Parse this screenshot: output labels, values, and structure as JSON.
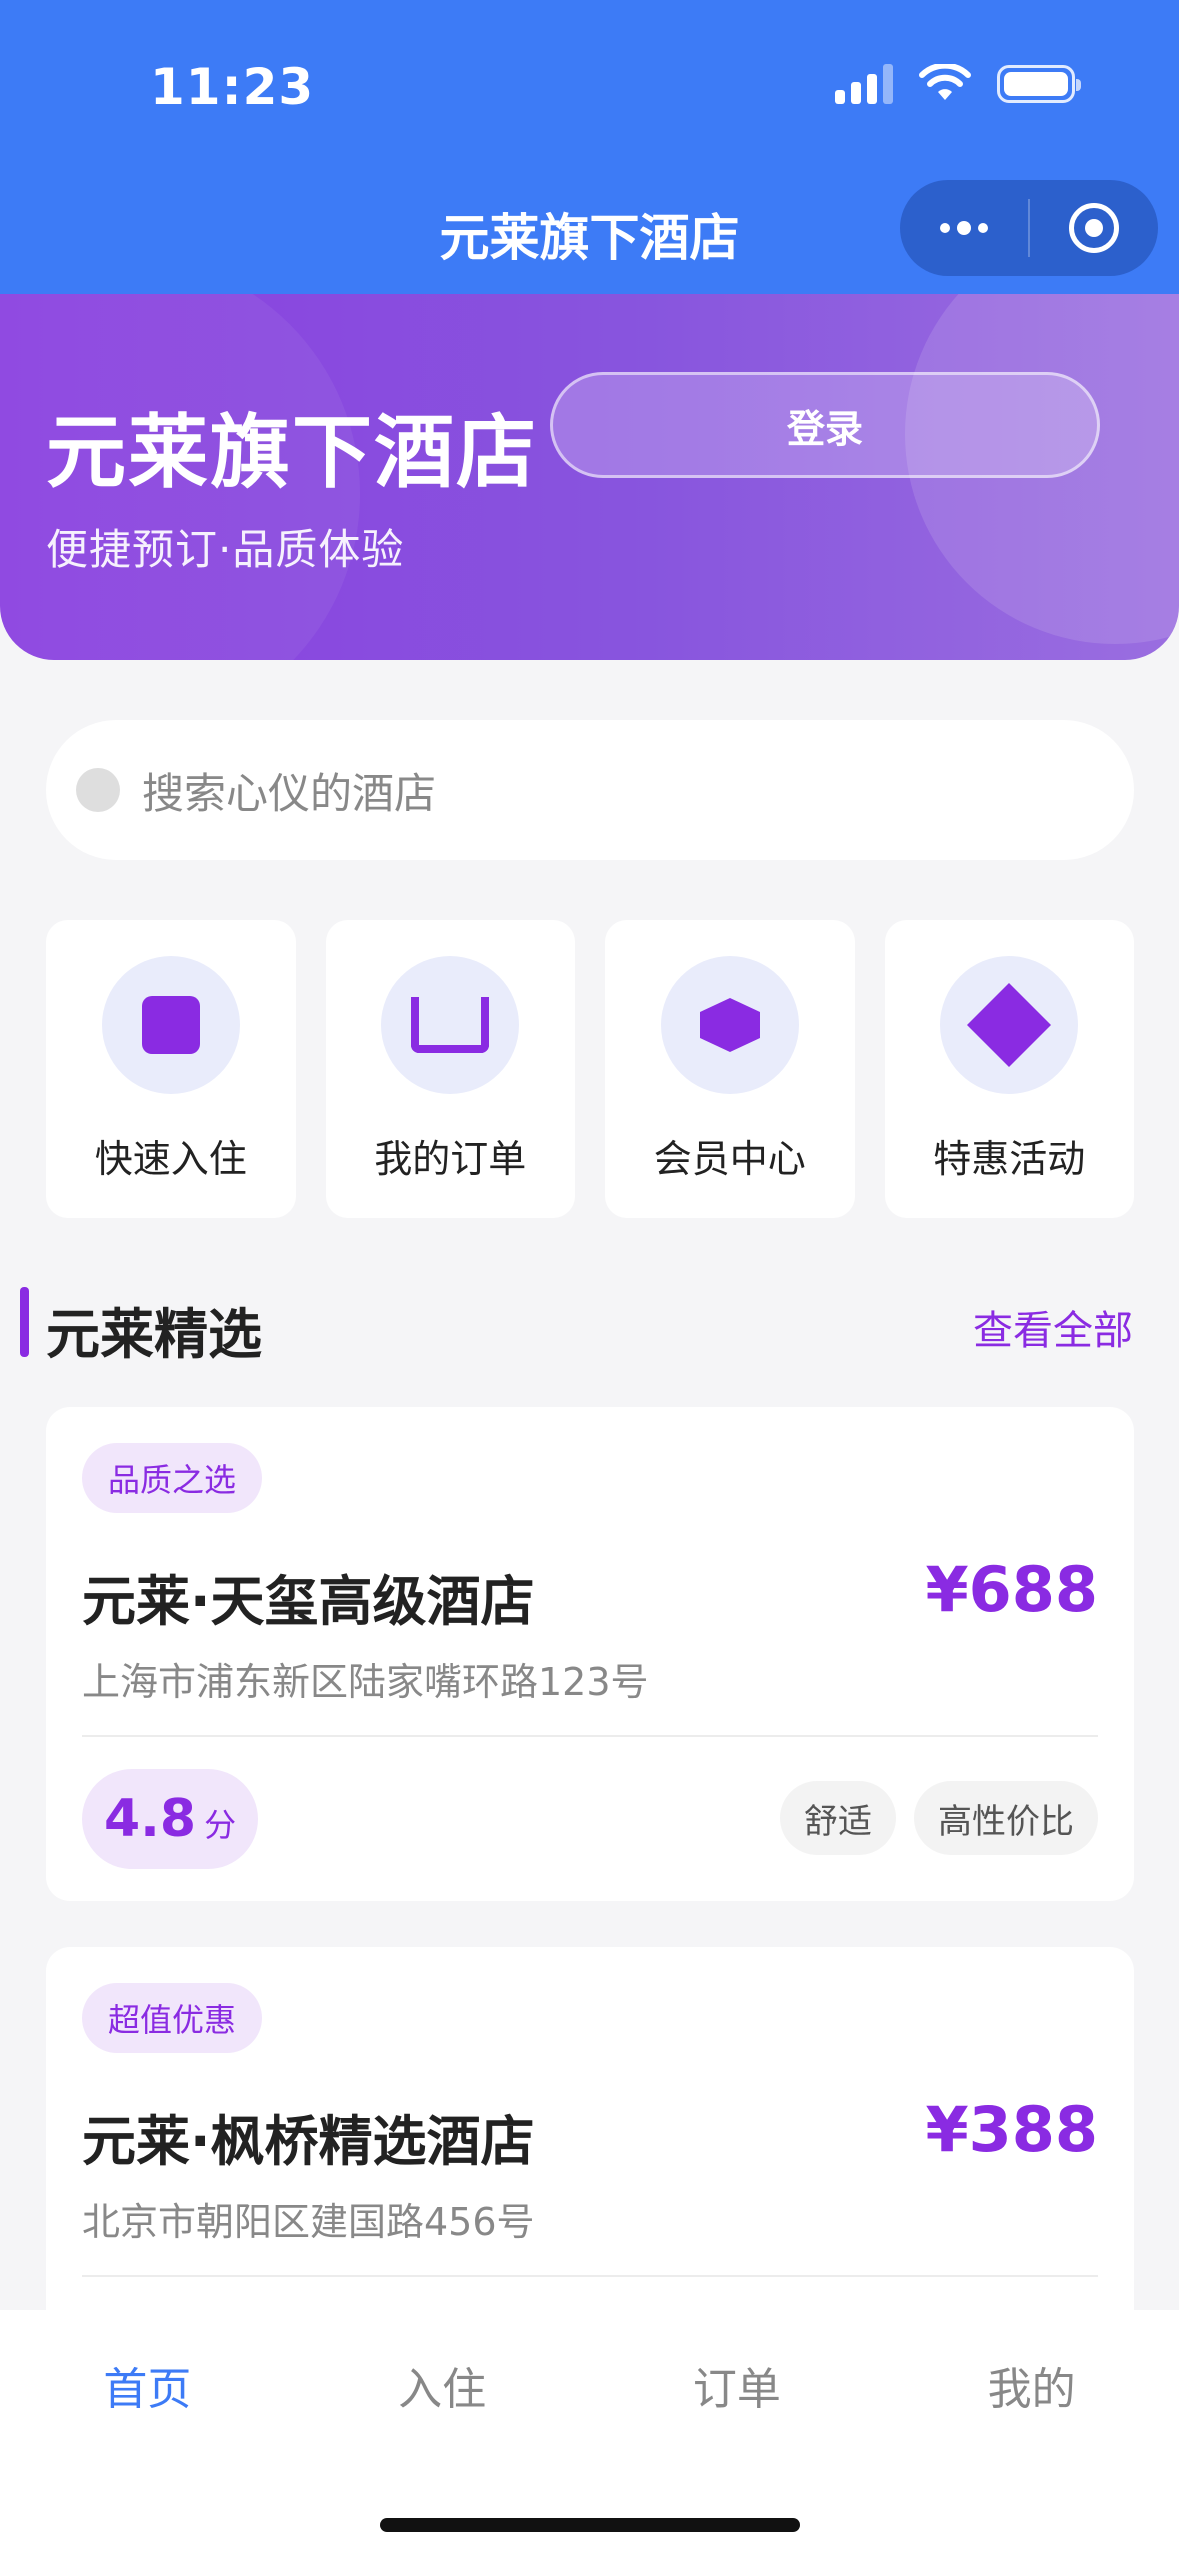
{
  "status": {
    "time": "11:23"
  },
  "nav": {
    "title": "元莱旗下酒店"
  },
  "hero": {
    "title": "元莱旗下酒店",
    "subtitle": "便捷预订·品质体验",
    "login_label": "登录"
  },
  "search": {
    "placeholder": "搜索心仪的酒店"
  },
  "quick_actions": [
    {
      "label": "快速入住",
      "icon": "square-icon"
    },
    {
      "label": "我的订单",
      "icon": "tray-icon"
    },
    {
      "label": "会员中心",
      "icon": "hexagon-icon"
    },
    {
      "label": "特惠活动",
      "icon": "diamond-icon"
    }
  ],
  "section": {
    "title": "元莱精选",
    "more_label": "查看全部"
  },
  "hotels": [
    {
      "tag": "品质之选",
      "name": "元莱·天玺高级酒店",
      "price": "¥688",
      "address": "上海市浦东新区陆家嘴环路123号",
      "rating": "4.8",
      "rating_unit": "分",
      "features": [
        "舒适",
        "高性价比"
      ]
    },
    {
      "tag": "超值优惠",
      "name": "元莱·枫桥精选酒店",
      "price": "¥388",
      "address": "北京市朝阳区建国路456号"
    }
  ],
  "tabs": [
    {
      "label": "首页",
      "active": true
    },
    {
      "label": "入住",
      "active": false
    },
    {
      "label": "订单",
      "active": false
    },
    {
      "label": "我的",
      "active": false
    }
  ],
  "colors": {
    "nav_blue": "#3d7bf6",
    "accent_purple": "#8a2be2",
    "hero_gradient_start": "#8a3fe0"
  }
}
